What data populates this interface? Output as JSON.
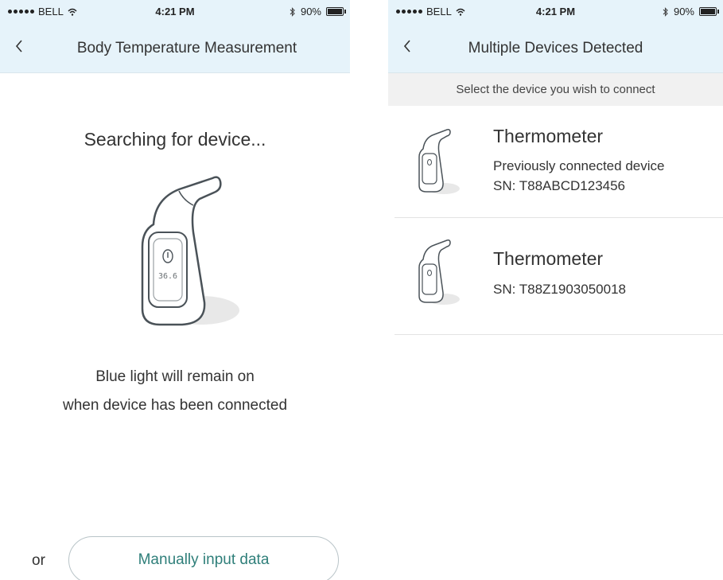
{
  "status_bar": {
    "carrier": "BELL",
    "time": "4:21 PM",
    "battery": "90%"
  },
  "left_screen": {
    "nav_title": "Body Temperature Measurement",
    "status_text": "Searching for device...",
    "device_display_reading": "36.6",
    "hint_line1": "Blue light will remain on",
    "hint_line2": "when device has been connected",
    "or_label": "or",
    "manual_button": "Manually input data"
  },
  "right_screen": {
    "nav_title": "Multiple Devices Detected",
    "subheader": "Select the device you wish to connect",
    "devices": [
      {
        "name": "Thermometer",
        "note": "Previously connected device",
        "sn": "SN: T88ABCD123456"
      },
      {
        "name": "Thermometer",
        "note": "",
        "sn": "SN: T88Z1903050018"
      }
    ]
  },
  "icons": [
    "back-chevron-icon",
    "wifi-icon",
    "bluetooth-icon",
    "battery-icon",
    "thermometer-device-icon"
  ],
  "colors": {
    "nav_bg": "#e6f3fa",
    "button_text": "#2f7f7a",
    "button_border": "#b9c4c8",
    "subheader_bg": "#f1f1f1"
  }
}
